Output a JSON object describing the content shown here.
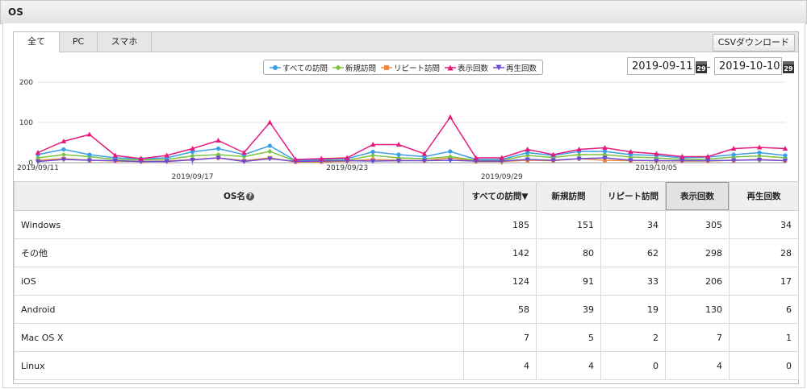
{
  "panel": {
    "title": "OS"
  },
  "tabs": [
    {
      "label": "全て",
      "active": true
    },
    {
      "label": "PC",
      "active": false
    },
    {
      "label": "スマホ",
      "active": false
    }
  ],
  "csv_button": "CSVダウンロード",
  "date_range": {
    "start": "2019-09-11",
    "separator": "-",
    "end": "2019-10-10",
    "calendar_icon_text": "29"
  },
  "chart_data": {
    "type": "line",
    "x": [
      "2019/09/11",
      "2019/09/12",
      "2019/09/13",
      "2019/09/14",
      "2019/09/15",
      "2019/09/16",
      "2019/09/17",
      "2019/09/18",
      "2019/09/19",
      "2019/09/20",
      "2019/09/21",
      "2019/09/22",
      "2019/09/23",
      "2019/09/24",
      "2019/09/25",
      "2019/09/26",
      "2019/09/27",
      "2019/09/28",
      "2019/09/29",
      "2019/09/30",
      "2019/10/01",
      "2019/10/02",
      "2019/10/03",
      "2019/10/04",
      "2019/10/05",
      "2019/10/06",
      "2019/10/07",
      "2019/10/08",
      "2019/10/09",
      "2019/10/10"
    ],
    "tick_labels": [
      "2019/09/11",
      "2019/09/17",
      "2019/09/23",
      "2019/09/29",
      "2019/10/05"
    ],
    "ylim": [
      0,
      200
    ],
    "yticks": [
      0,
      100,
      200
    ],
    "grid": true,
    "legend_position": "top-center",
    "series": [
      {
        "name": "すべての訪問",
        "color": "#3a9ee8",
        "marker": "circle",
        "values": [
          20,
          33,
          20,
          12,
          10,
          12,
          27,
          35,
          20,
          42,
          5,
          8,
          10,
          27,
          20,
          15,
          28,
          8,
          8,
          25,
          18,
          28,
          28,
          20,
          18,
          12,
          14,
          20,
          25,
          18
        ]
      },
      {
        "name": "新規訪問",
        "color": "#7cc142",
        "marker": "diamond",
        "values": [
          12,
          20,
          15,
          8,
          7,
          8,
          17,
          20,
          15,
          28,
          4,
          6,
          6,
          18,
          12,
          10,
          15,
          6,
          6,
          18,
          13,
          20,
          20,
          14,
          12,
          8,
          9,
          14,
          17,
          12
        ]
      },
      {
        "name": "リピート訪問",
        "color": "#f58a3c",
        "marker": "square",
        "values": [
          6,
          10,
          6,
          4,
          3,
          4,
          8,
          12,
          5,
          12,
          2,
          2,
          4,
          8,
          6,
          5,
          12,
          3,
          3,
          6,
          5,
          10,
          6,
          5,
          5,
          4,
          4,
          6,
          8,
          5
        ]
      },
      {
        "name": "表示回数",
        "color": "#e6197c",
        "marker": "triangle-up",
        "values": [
          25,
          53,
          70,
          18,
          10,
          18,
          35,
          55,
          25,
          100,
          8,
          10,
          12,
          45,
          45,
          22,
          113,
          12,
          12,
          33,
          20,
          33,
          37,
          27,
          22,
          15,
          15,
          35,
          38,
          35
        ]
      },
      {
        "name": "再生回数",
        "color": "#6a4bd1",
        "marker": "triangle-down",
        "values": [
          3,
          8,
          6,
          5,
          3,
          3,
          7,
          12,
          3,
          10,
          3,
          4,
          5,
          4,
          5,
          5,
          6,
          4,
          4,
          8,
          6,
          10,
          12,
          6,
          5,
          5,
          5,
          6,
          7,
          5
        ]
      }
    ]
  },
  "table": {
    "headers": [
      {
        "label": "OS名",
        "help": "?"
      },
      {
        "label": "すべての訪問▼"
      },
      {
        "label": "新規訪問"
      },
      {
        "label": "リピート訪問"
      },
      {
        "label": "表示回数"
      },
      {
        "label": "再生回数"
      }
    ],
    "rows": [
      {
        "os": "Windows",
        "all": "185",
        "new": "151",
        "repeat": "34",
        "views": "305",
        "plays": "34"
      },
      {
        "os": "その他",
        "all": "142",
        "new": "80",
        "repeat": "62",
        "views": "298",
        "plays": "28"
      },
      {
        "os": "iOS",
        "all": "124",
        "new": "91",
        "repeat": "33",
        "views": "206",
        "plays": "17"
      },
      {
        "os": "Android",
        "all": "58",
        "new": "39",
        "repeat": "19",
        "views": "130",
        "plays": "6"
      },
      {
        "os": "Mac OS X",
        "all": "7",
        "new": "5",
        "repeat": "2",
        "views": "7",
        "plays": "1"
      },
      {
        "os": "Linux",
        "all": "4",
        "new": "4",
        "repeat": "0",
        "views": "4",
        "plays": "0"
      }
    ]
  }
}
